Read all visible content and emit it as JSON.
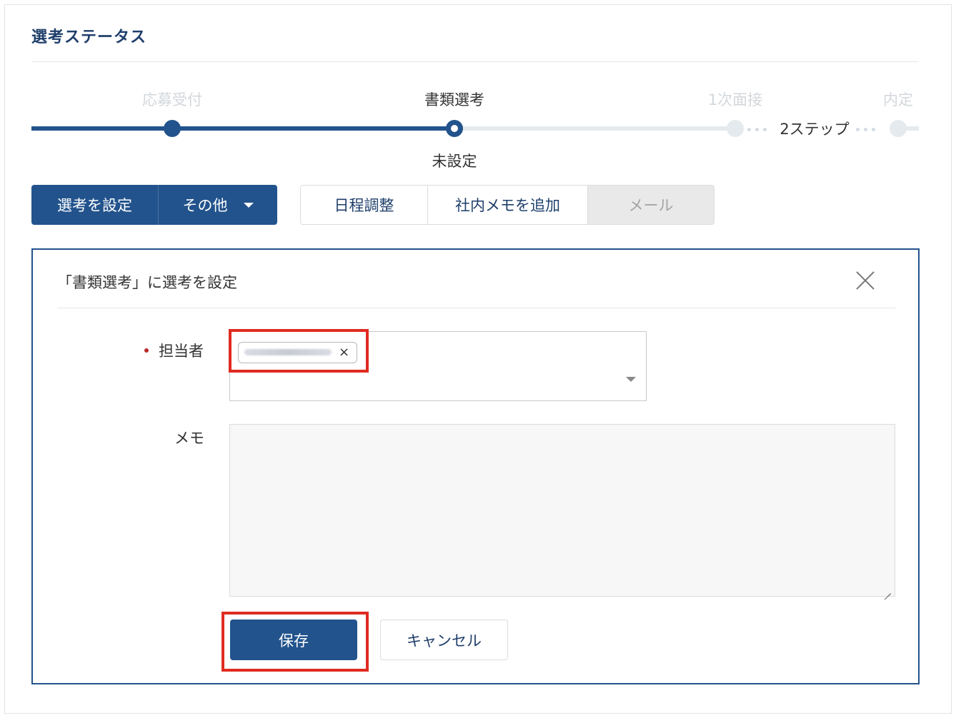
{
  "header": {
    "title": "選考ステータス"
  },
  "progress": {
    "steps": [
      {
        "label": "応募受付",
        "state": "done"
      },
      {
        "label": "書類選考",
        "state": "current"
      },
      {
        "label": "1次面接",
        "state": "todo"
      },
      {
        "label": "内定",
        "state": "todo"
      }
    ],
    "skipped_label": "2ステップ",
    "current_status": "未設定"
  },
  "actions": {
    "set_selection": "選考を設定",
    "other": "その他",
    "schedule": "日程調整",
    "add_memo": "社内メモを追加",
    "mail": "メール"
  },
  "panel": {
    "title": "「書類選考」に選考を設定",
    "assignee_label": "担当者",
    "tag_remove": "×",
    "memo_label": "メモ",
    "memo_value": "",
    "save_label": "保存",
    "cancel_label": "キャンセル"
  },
  "colors": {
    "primary": "#22538c",
    "highlight": "#e02b20",
    "required": "#b72a2a"
  }
}
